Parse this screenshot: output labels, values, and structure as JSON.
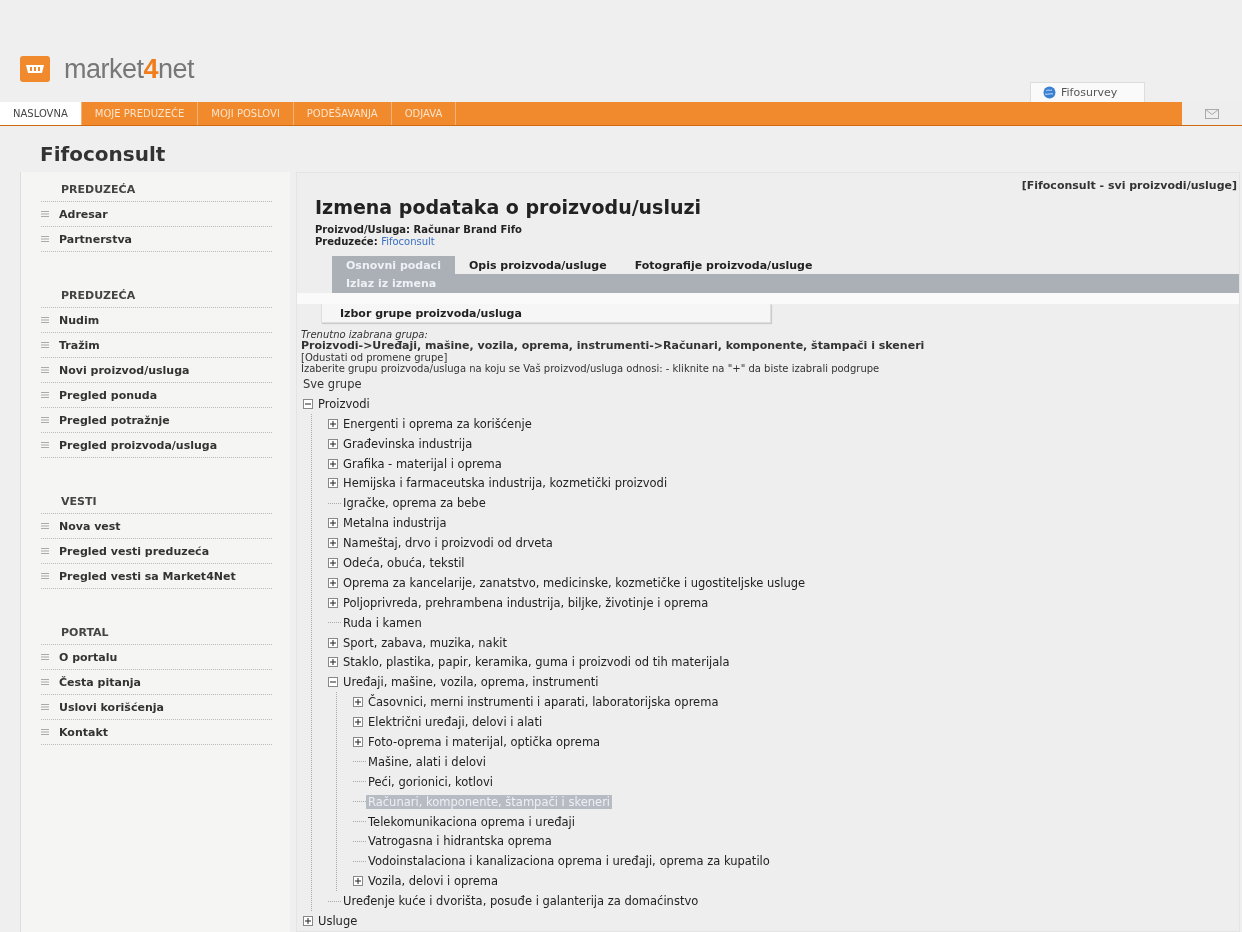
{
  "header": {
    "logo_text": {
      "before": "market",
      "accent": "4",
      "after": "net"
    },
    "survey_tab": "Fifosurvey"
  },
  "nav": [
    {
      "label": "NASLOVNA",
      "selected": true
    },
    {
      "label": "MOJE PREDUZEĆE",
      "selected": false
    },
    {
      "label": "MOJI POSLOVI",
      "selected": false
    },
    {
      "label": "PODEŠAVANJA",
      "selected": false
    },
    {
      "label": "ODJAVA",
      "selected": false
    }
  ],
  "company_title": "Fifoconsult",
  "sidebar": [
    {
      "heading": "PREDUZEĆA",
      "items": [
        "Adresar",
        "Partnerstva"
      ]
    },
    {
      "heading": "PREDUZEĆA",
      "items": [
        "Nudim",
        "Tražim",
        "Novi proizvod/usluga",
        "Pregled ponuda",
        "Pregled potražnje",
        "Pregled proizvoda/usluga"
      ]
    },
    {
      "heading": "VESTI",
      "items": [
        "Nova vest",
        "Pregled vesti preduzeća",
        "Pregled vesti sa Market4Net"
      ]
    },
    {
      "heading": "PORTAL",
      "items": [
        "O portalu",
        "Česta pitanja",
        "Uslovi korišćenja",
        "Kontakt"
      ]
    }
  ],
  "content": {
    "top_link": "[Fifoconsult - svi proizvodi/usluge]",
    "title": "Izmena podataka o proizvodu/usluzi",
    "product_line": "Proizvod/Usluga: Računar Brand Fifo",
    "company_label": "Preduzeće:",
    "company_link": "Fifoconsult",
    "tabs": [
      {
        "label": "Osnovni podaci",
        "selected": true
      },
      {
        "label": "Opis proizvoda/usluge",
        "selected": false
      },
      {
        "label": "Fotografije proizvoda/usluge",
        "selected": false
      }
    ],
    "exit_link": "Izlaz iz izmena",
    "section_title": "Izbor grupe proizvoda/usluga",
    "current_label": "Trenutno izabrana grupa:",
    "current_path": "Proizvodi->Uređaji, mašine, vozila, oprema, instrumenti->Računari, komponente, štampači i skeneri",
    "cancel_link": "[Odustati od promene grupe]",
    "instructions": "Izaberite grupu proizvoda/usluga na koju se Vaš proizvod/usluga odnosi: - kliknite na \"+\" da biste izabrali podgrupe",
    "tree_root": "Sve grupe",
    "tree": [
      {
        "label": "Proizvodi",
        "kind": "branch",
        "expanded": true,
        "selected": false,
        "children": [
          {
            "label": "Energenti i oprema za korišćenje",
            "kind": "branch",
            "expanded": false,
            "selected": false
          },
          {
            "label": "Građevinska industrija",
            "kind": "branch",
            "expanded": false,
            "selected": false
          },
          {
            "label": "Grafika - materijal i oprema",
            "kind": "branch",
            "expanded": false,
            "selected": false
          },
          {
            "label": "Hemijska i farmaceutska industrija, kozmetički proizvodi",
            "kind": "branch",
            "expanded": false,
            "selected": false
          },
          {
            "label": "Igračke, oprema za bebe",
            "kind": "leaf",
            "selected": false
          },
          {
            "label": "Metalna industrija",
            "kind": "branch",
            "expanded": false,
            "selected": false
          },
          {
            "label": "Nameštaj, drvo i proizvodi od drveta",
            "kind": "branch",
            "expanded": false,
            "selected": false
          },
          {
            "label": "Odeća, obuća, tekstil",
            "kind": "branch",
            "expanded": false,
            "selected": false
          },
          {
            "label": "Oprema za kancelarije, zanatstvo, medicinske, kozmetičke i ugostiteljske usluge",
            "kind": "branch",
            "expanded": false,
            "selected": false
          },
          {
            "label": "Poljoprivreda, prehrambena industrija, biljke, životinje i oprema",
            "kind": "branch",
            "expanded": false,
            "selected": false
          },
          {
            "label": "Ruda i kamen",
            "kind": "leaf",
            "selected": false
          },
          {
            "label": "Sport, zabava, muzika, nakit",
            "kind": "branch",
            "expanded": false,
            "selected": false
          },
          {
            "label": "Staklo, plastika, papir, keramika, guma i proizvodi od tih materijala",
            "kind": "branch",
            "expanded": false,
            "selected": false
          },
          {
            "label": "Uređaji, mašine, vozila, oprema, instrumenti",
            "kind": "branch",
            "expanded": true,
            "selected": false,
            "children": [
              {
                "label": "Časovnici, merni instrumenti i aparati, laboratorijska oprema",
                "kind": "branch",
                "expanded": false,
                "selected": false
              },
              {
                "label": "Električni uređaji, delovi i alati",
                "kind": "branch",
                "expanded": false,
                "selected": false
              },
              {
                "label": "Foto-oprema i materijal, optička oprema",
                "kind": "branch",
                "expanded": false,
                "selected": false
              },
              {
                "label": "Mašine, alati i delovi",
                "kind": "leaf",
                "selected": false
              },
              {
                "label": "Peći, gorionici, kotlovi",
                "kind": "leaf",
                "selected": false
              },
              {
                "label": "Računari, komponente, štampači i skeneri",
                "kind": "leaf",
                "selected": true
              },
              {
                "label": "Telekomunikaciona oprema i uređaji",
                "kind": "leaf",
                "selected": false
              },
              {
                "label": "Vatrogasna i hidrantska oprema",
                "kind": "leaf",
                "selected": false
              },
              {
                "label": "Vodoinstalaciona i kanalizaciona oprema i uređaji, oprema za kupatilo",
                "kind": "leaf",
                "selected": false
              },
              {
                "label": "Vozila, delovi i oprema",
                "kind": "branch",
                "expanded": false,
                "selected": false
              }
            ]
          },
          {
            "label": "Uređenje kuće i dvorišta, posuđe i galanterija za domaćinstvo",
            "kind": "leaf",
            "selected": false
          }
        ]
      },
      {
        "label": "Usluge",
        "kind": "branch",
        "expanded": false,
        "selected": false
      }
    ]
  }
}
